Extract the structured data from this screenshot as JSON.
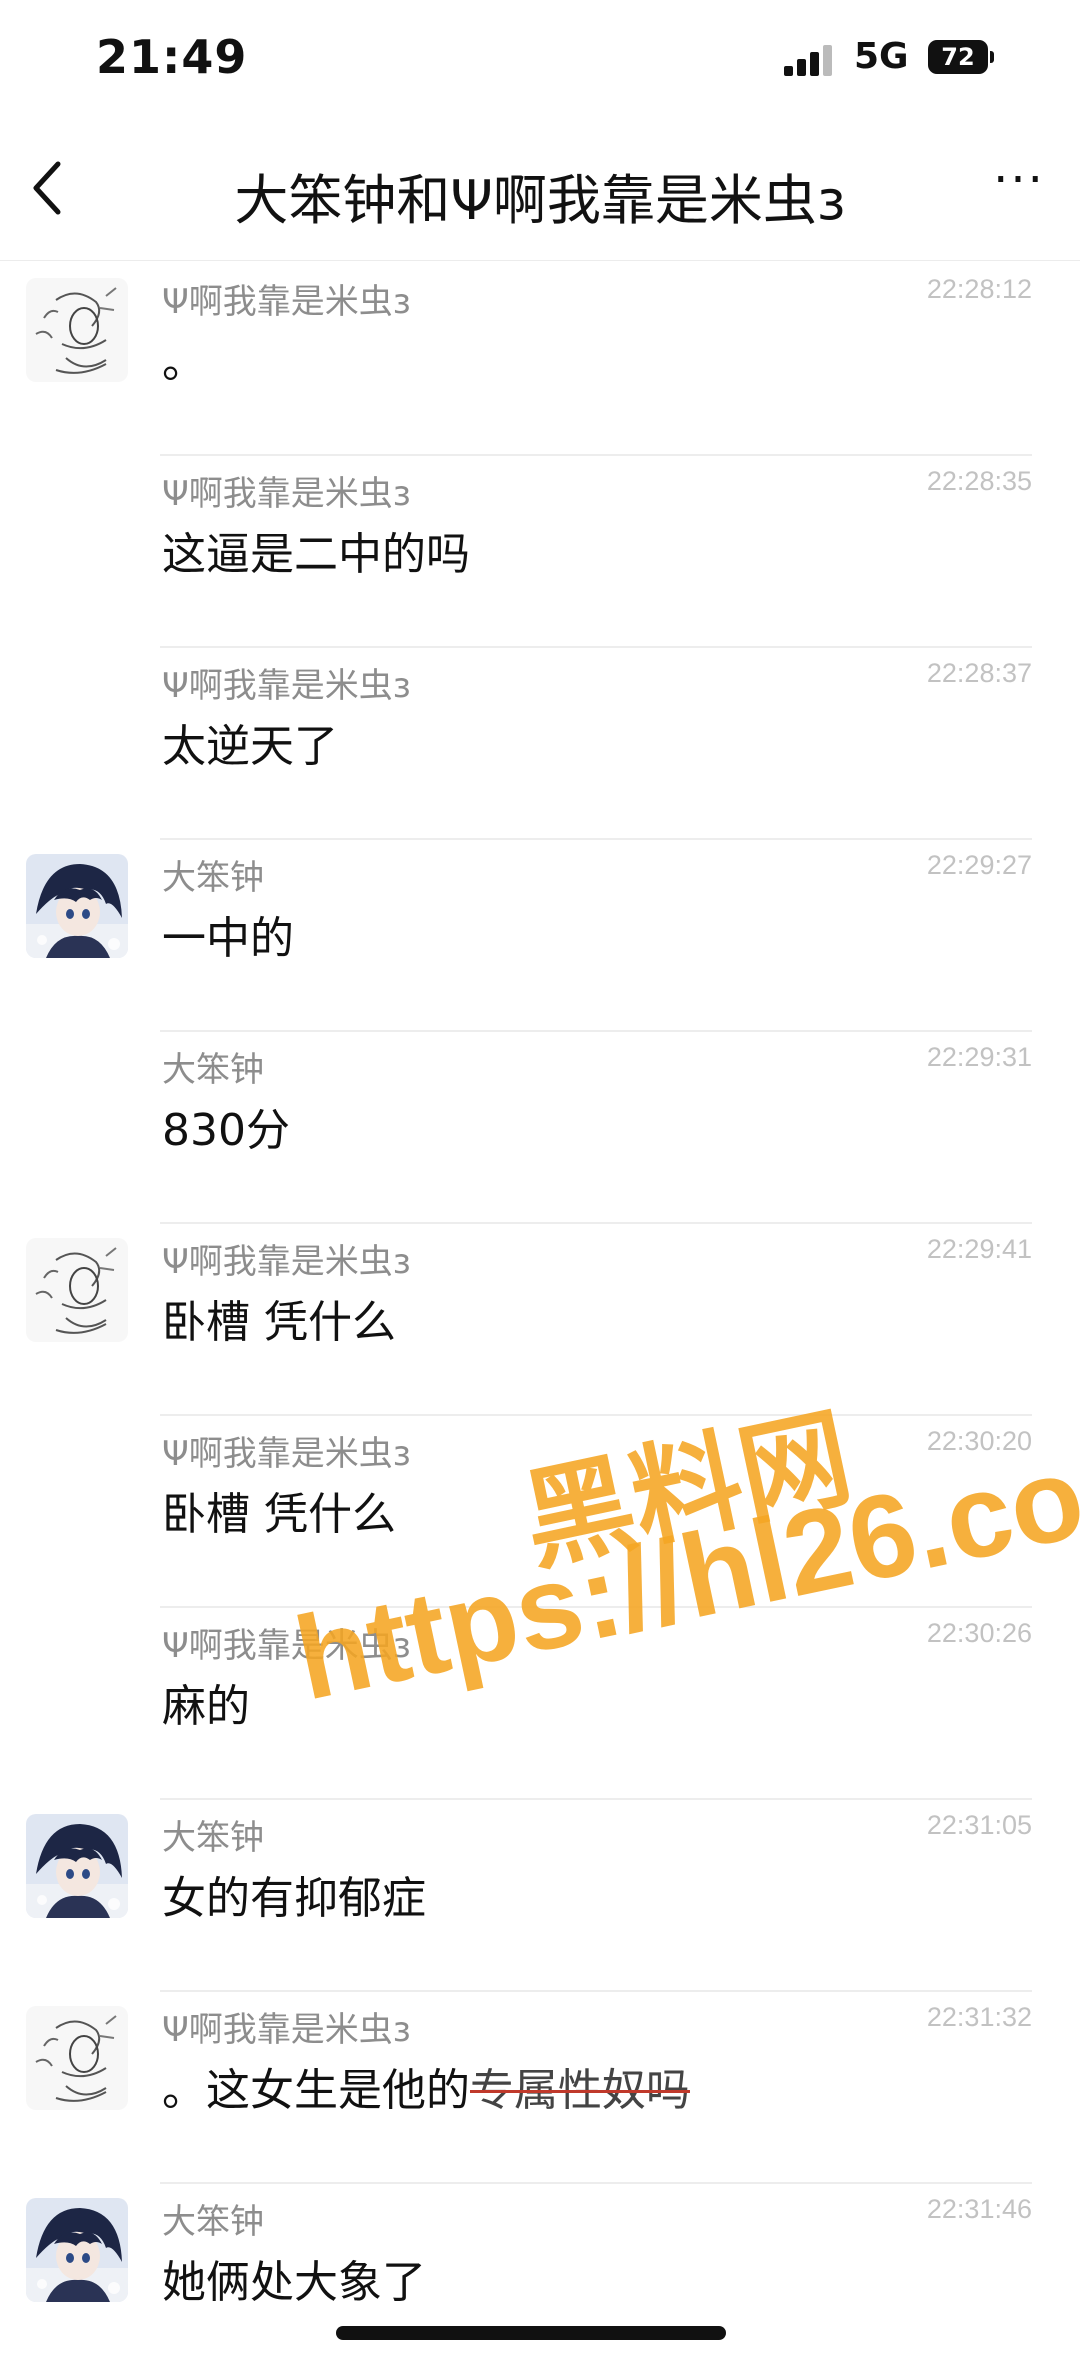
{
  "status_bar": {
    "time": "21:49",
    "network": "5G",
    "battery": "72"
  },
  "header": {
    "title": "大笨钟和Ψ啊我靠是米虫з",
    "more": "···"
  },
  "messages": [
    {
      "sender": "Ψ啊我靠是米虫з",
      "time": "22:28:12",
      "text": "。",
      "avatar": "sketch"
    },
    {
      "sender": "Ψ啊我靠是米虫з",
      "time": "22:28:35",
      "text": "这逼是二中的吗"
    },
    {
      "sender": "Ψ啊我靠是米虫з",
      "time": "22:28:37",
      "text": "太逆天了"
    },
    {
      "sender": "大笨钟",
      "time": "22:29:27",
      "text": "一中的",
      "avatar": "anime"
    },
    {
      "sender": "大笨钟",
      "time": "22:29:31",
      "text": "830分"
    },
    {
      "sender": "Ψ啊我靠是米虫з",
      "time": "22:29:41",
      "text": "卧槽 凭什么",
      "avatar": "sketch"
    },
    {
      "sender": "Ψ啊我靠是米虫з",
      "time": "22:30:20",
      "text": "卧槽 凭什么"
    },
    {
      "sender": "Ψ啊我靠是米虫з",
      "time": "22:30:26",
      "text": "麻的"
    },
    {
      "sender": "大笨钟",
      "time": "22:31:05",
      "text": "女的有抑郁症",
      "avatar": "anime"
    },
    {
      "sender": "Ψ啊我靠是米虫з",
      "time": "22:31:32",
      "text_prefix": "。这女生是他的",
      "text_struck": "专属性奴吗",
      "avatar": "sketch"
    },
    {
      "sender": "大笨钟",
      "time": "22:31:46",
      "text": "她俩处大象了",
      "avatar": "anime"
    }
  ],
  "watermark": {
    "line1": "黑料网",
    "line2": "https://hl26.co"
  }
}
